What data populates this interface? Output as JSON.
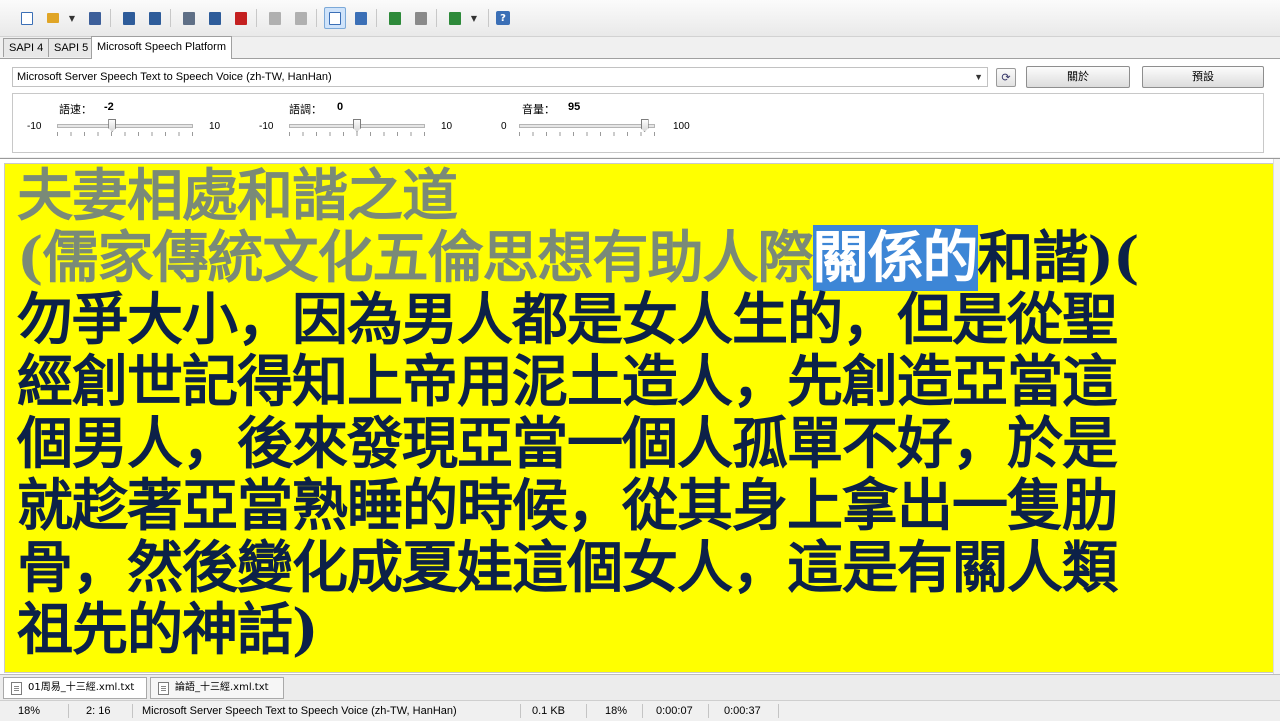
{
  "toolbar": {
    "buttons": [
      {
        "name": "new-file-icon",
        "color": "#3b6fb6"
      },
      {
        "name": "open-folder-icon",
        "color": "#e0a526"
      },
      {
        "name": "save-icon",
        "color": "#3d5f9a"
      },
      {
        "name": "export-wav-icon",
        "color": "#2e5c9a"
      },
      {
        "name": "batch-export-icon",
        "color": "#2e5c9a"
      },
      {
        "name": "play-icon",
        "color": "#5f6f86"
      },
      {
        "name": "pause-icon",
        "color": "#2e5c9a"
      },
      {
        "name": "stop-icon",
        "color": "#c42020"
      },
      {
        "name": "prev-icon",
        "color": "#9a9a9a"
      },
      {
        "name": "next-icon",
        "color": "#9a9a9a"
      },
      {
        "name": "view-text-icon",
        "color": "#3b6fb6"
      },
      {
        "name": "view-split-icon",
        "color": "#3b6fb6"
      },
      {
        "name": "copy-icon",
        "color": "#2e8a3a"
      },
      {
        "name": "paste-icon",
        "color": "#6f6f6f"
      },
      {
        "name": "voice-icon",
        "color": "#2e8a3a"
      },
      {
        "name": "help-icon",
        "color": "#3b6fb6"
      }
    ]
  },
  "tabs": [
    "SAPI 4",
    "SAPI 5",
    "Microsoft Speech Platform"
  ],
  "voice": {
    "selected": "Microsoft Server Speech Text to Speech Voice (zh-TW, HanHan)",
    "about_label": "關於",
    "default_label": "預設"
  },
  "sliders": {
    "rate": {
      "label": "語速：",
      "value": "-2",
      "min": "-10",
      "max": "10",
      "level": 0.4
    },
    "pitch": {
      "label": "語調：",
      "value": "0",
      "min": "-10",
      "max": "10",
      "level": 0.5
    },
    "volume": {
      "label": "音量：",
      "value": "95",
      "min": "0",
      "max": "100",
      "level": 0.95
    }
  },
  "document": {
    "line1": "夫妻相處和諧之道",
    "line2_read": "(儒家傳統文化五倫思想有助人際",
    "line2_highlight": "關係的",
    "line2_rest": "和諧)(",
    "line3": "勿爭大小，因為男人都是女人生的，但是從聖",
    "line4": "經創世記得知上帝用泥土造人，先創造亞當這",
    "line5": "個男人，後來發現亞當一個人孤單不好，於是",
    "line6": "就趁著亞當熟睡的時候，從其身上拿出一隻肋",
    "line7": "骨，然後變化成夏娃這個女人，這是有關人類",
    "line8": "祖先的神話)",
    "text_color": "#0c2148",
    "read_color": "#7a8a78",
    "background": "#ffff00",
    "highlight_color": "#3d86d6"
  },
  "files": [
    "01周易_十三經.xml.txt",
    "論語_十三經.xml.txt"
  ],
  "status": {
    "progress": "18%",
    "position": "2:  16",
    "voice": "Microsoft Server Speech Text to Speech Voice (zh-TW, HanHan)",
    "size": "0.1 KB",
    "percent": "18%",
    "elapsed": "0:00:07",
    "total": "0:00:37"
  }
}
